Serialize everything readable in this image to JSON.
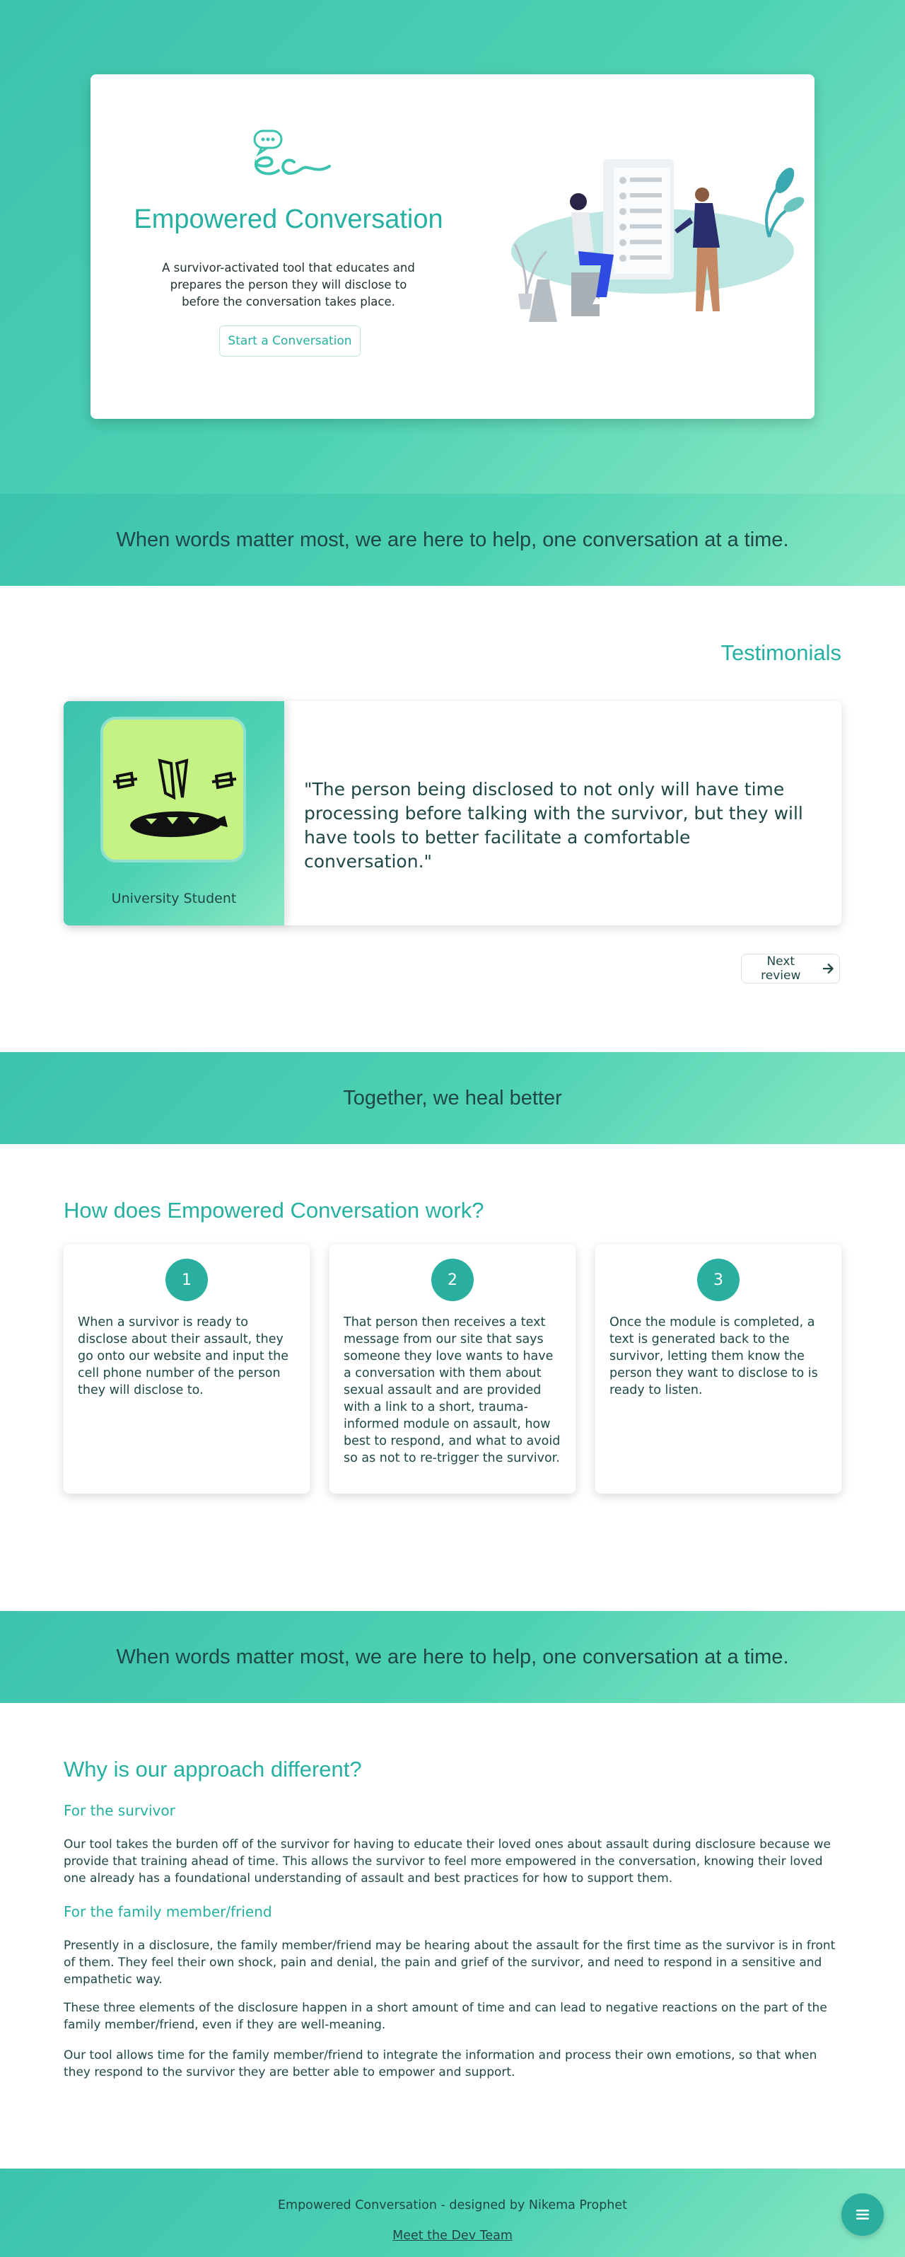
{
  "hero": {
    "title": "Empowered Conversation",
    "description": "A survivor-activated tool that educates and prepares the person they will disclose to before the conversation takes place.",
    "cta_label": "Start a Conversation",
    "logo_icon": "ec-chat-logo-icon",
    "illustration": "people-conversation-illustration"
  },
  "banner_1": {
    "text": "When words matter most, we are here to help, one conversation at a time."
  },
  "testimonials": {
    "heading": "Testimonials",
    "current": {
      "author": "University Student",
      "quote": "\"The person being disclosed to not only will have time processing before talking with the survivor, but they will have tools to better facilitate a comfortable conversation.\""
    },
    "next_label": "Next review",
    "next_icon": "arrow-right-icon"
  },
  "banner_2": {
    "text": "Together, we heal better"
  },
  "how_it_works": {
    "heading": "How does Empowered Conversation work?",
    "steps": [
      {
        "number": "1",
        "text": "When a survivor is ready to disclose about their assault, they go onto our website and input the cell phone number of the person they will disclose to."
      },
      {
        "number": "2",
        "text": "That person then receives a text message from our site that says someone they love wants to have a conversation with them about sexual assault and are provided with a link to a short, trauma-informed module on assault, how best to respond, and what to avoid so as not to re-trigger the survivor."
      },
      {
        "number": "3",
        "text": "Once the module is completed, a text is generated back to the survivor, letting them know the person they want to disclose to is ready to listen."
      }
    ]
  },
  "banner_3": {
    "text": "When words matter most, we are here to help, one conversation at a time."
  },
  "why_different": {
    "heading": "Why is our approach different?",
    "survivor_heading": "For the survivor",
    "survivor_text": "Our tool takes the burden off of the survivor for having to educate their loved ones about assault during disclosure because we provide that training ahead of time. This allows the survivor to feel more empowered in the conversation, knowing their loved one already has a foundational understanding of assault and best practices for how to support them.",
    "family_heading": "For the family member/friend",
    "family_text_1": "Presently in a disclosure, the family member/friend may be hearing about the assault for the first time as the survivor is in front of them. They feel their own shock, pain and denial, the pain and grief of the survivor, and need to respond in a sensitive and empathetic way.",
    "family_text_2": "These three elements of the disclosure happen in a short amount of time and can lead to negative reactions on the part of the family member/friend, even if they are well-meaning.",
    "family_text_3": "Our tool allows time for the family member/friend to integrate the information and process their own emotions, so that when they respond to the survivor they are better able to empower and support."
  },
  "footer": {
    "credit": "Empowered Conversation - designed by Nikema Prophet",
    "team_link": "Meet the Dev Team",
    "menu_icon": "menu-icon"
  },
  "colors": {
    "accent": "#25b0a1",
    "gradient_start": "#3cc3ad",
    "gradient_end": "#8ae8c3",
    "text": "#1f4747"
  }
}
